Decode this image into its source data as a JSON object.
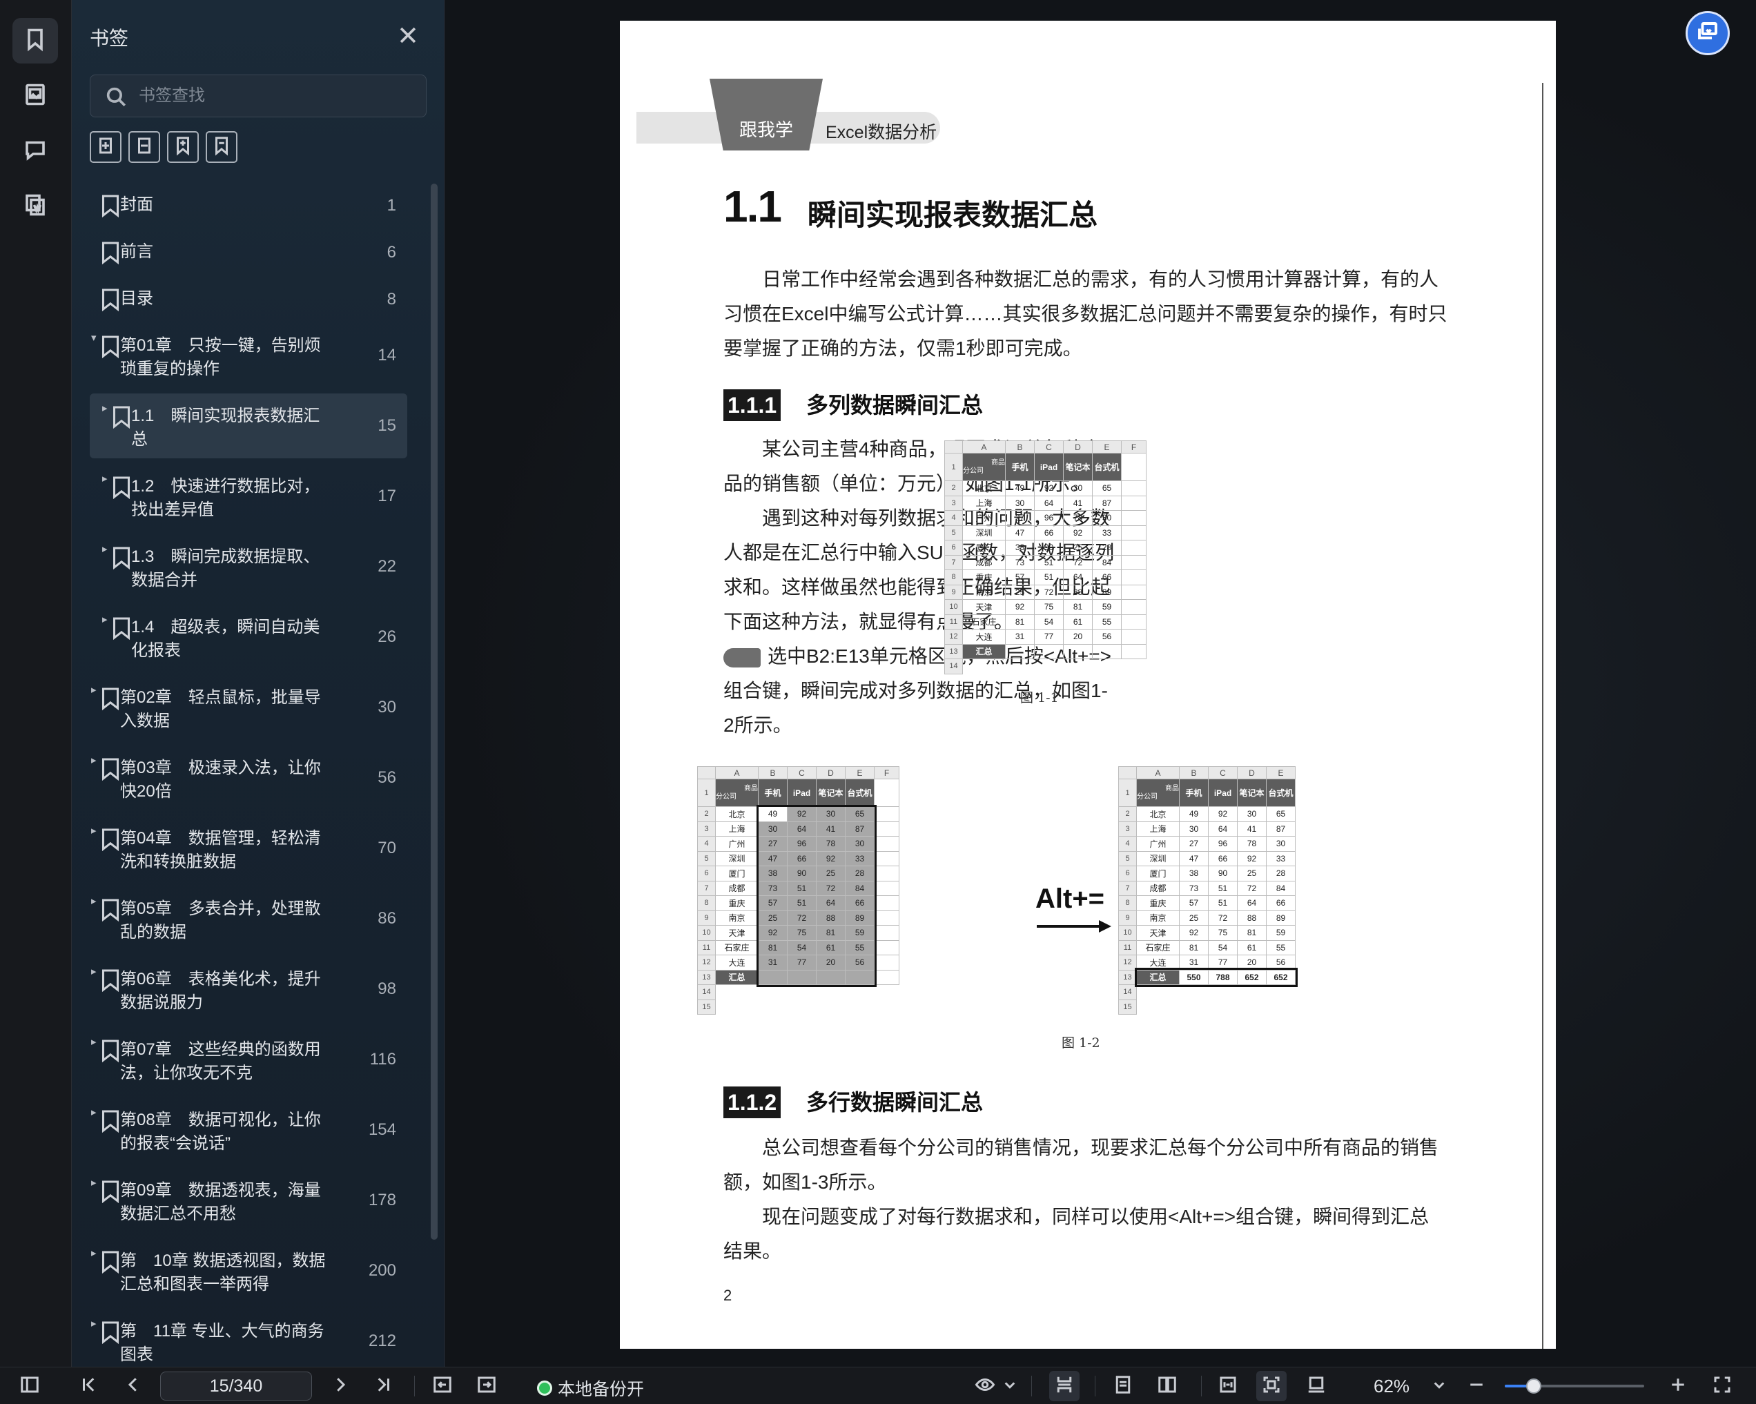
{
  "panel": {
    "title": "书签",
    "search_placeholder": "书签查找",
    "items": [
      {
        "label": "封面",
        "page": "1",
        "level": 0,
        "caret": "",
        "single": true
      },
      {
        "label": "前言",
        "page": "6",
        "level": 0,
        "caret": "",
        "single": true
      },
      {
        "label": "目录",
        "page": "8",
        "level": 0,
        "caret": "",
        "single": true
      },
      {
        "label": "第01章　只按一键，告别烦琐重复的操作",
        "page": "14",
        "level": 0,
        "caret": "▾",
        "single": false
      },
      {
        "label": "1.1　瞬间实现报表数据汇总",
        "page": "15",
        "level": 1,
        "caret": "▸",
        "single": false,
        "selected": true
      },
      {
        "label": "1.2　快速进行数据比对，找出差异值",
        "page": "17",
        "level": 1,
        "caret": "▸",
        "single": false
      },
      {
        "label": "1.3　瞬间完成数据提取、数据合并",
        "page": "22",
        "level": 1,
        "caret": "▸",
        "single": false
      },
      {
        "label": "1.4　超级表，瞬间自动美化报表",
        "page": "26",
        "level": 1,
        "caret": "▸",
        "single": false
      },
      {
        "label": "第02章　轻点鼠标，批量导入数据",
        "page": "30",
        "level": 0,
        "caret": "▸",
        "single": false
      },
      {
        "label": "第03章　极速录入法，让你快20倍",
        "page": "56",
        "level": 0,
        "caret": "▸",
        "single": false
      },
      {
        "label": "第04章　数据管理，轻松清洗和转换脏数据",
        "page": "70",
        "level": 0,
        "caret": "▸",
        "single": false
      },
      {
        "label": "第05章　多表合并，处理散乱的数据",
        "page": "86",
        "level": 0,
        "caret": "▸",
        "single": false
      },
      {
        "label": "第06章　表格美化术，提升数据说服力",
        "page": "98",
        "level": 0,
        "caret": "▸",
        "single": false
      },
      {
        "label": "第07章　这些经典的函数用法，让你攻无不克",
        "page": "116",
        "level": 0,
        "caret": "▸",
        "single": false
      },
      {
        "label": "第08章　数据可视化，让你的报表“会说话”",
        "page": "154",
        "level": 0,
        "caret": "▸",
        "single": false
      },
      {
        "label": "第09章　数据透视表，海量数据汇总不用愁",
        "page": "178",
        "level": 0,
        "caret": "▸",
        "single": false
      },
      {
        "label": "第　10章 数据透视图，数据汇总和图表一举两得",
        "page": "200",
        "level": 0,
        "caret": "▸",
        "single": false
      },
      {
        "label": "第　11章 专业、大气的商务图表",
        "page": "212",
        "level": 0,
        "caret": "▸",
        "single": false
      }
    ]
  },
  "page": {
    "header_badge": "跟我学",
    "header_text": "Excel数据分析",
    "h1_num": "1.1",
    "h1": "瞬间实现报表数据汇总",
    "intro": "日常工作中经常会遇到各种数据汇总的需求，有的人习惯用计算器计算，有的人习惯在Excel中编写公式计算……其实很多数据汇总问题并不需要复杂的操作，有时只要掌握了正确的方法，仅需1秒即可完成。",
    "s1_num": "1.1.1",
    "s1_title": "多列数据瞬间汇总",
    "s1_p1": "某公司主营4种商品，现要求汇总每种商品的销售额（单位：万元），如图1-1所示。",
    "s1_p2": "遇到这种对每列数据求和的问题，大多数人都是在汇总行中输入SUM函数，对数据逐列求和。这样做虽然也能得到正确结果，但比起下面这种方法，就显得有点慢了。",
    "s1_step": "选中B2:E13单元格区域，然后按<Alt+=>组合键，瞬间完成对多列数据的汇总，如图1-2所示。",
    "fig1": "图 1-1",
    "fig2": "图 1-2",
    "alt_label": "Alt+=",
    "s2_num": "1.1.2",
    "s2_title": "多行数据瞬间汇总",
    "s2_p1": "总公司想查看每个分公司的销售情况，现要求汇总每个分公司中所有商品的销售额，如图1-3所示。",
    "s2_p2": "现在问题变成了对每行数据求和，同样可以使用<Alt+=>组合键，瞬间得到汇总结果。",
    "page_number": "2",
    "sheet": {
      "cols": [
        "A",
        "B",
        "C",
        "D",
        "E",
        "F"
      ],
      "corner_top": "商品",
      "corner_bottom": "分公司",
      "headers": [
        "手机",
        "iPad",
        "笔记本",
        "台式机"
      ],
      "rows": [
        {
          "name": "北京",
          "v": [
            "49",
            "92",
            "30",
            "65"
          ]
        },
        {
          "name": "上海",
          "v": [
            "30",
            "64",
            "41",
            "87"
          ]
        },
        {
          "name": "广州",
          "v": [
            "27",
            "96",
            "78",
            "30"
          ]
        },
        {
          "name": "深圳",
          "v": [
            "47",
            "66",
            "92",
            "33"
          ]
        },
        {
          "name": "厦门",
          "v": [
            "38",
            "90",
            "25",
            "28"
          ]
        },
        {
          "name": "成都",
          "v": [
            "73",
            "51",
            "72",
            "84"
          ]
        },
        {
          "name": "重庆",
          "v": [
            "57",
            "51",
            "64",
            "66"
          ]
        },
        {
          "name": "南京",
          "v": [
            "25",
            "72",
            "88",
            "89"
          ]
        },
        {
          "name": "天津",
          "v": [
            "92",
            "75",
            "81",
            "59"
          ]
        },
        {
          "name": "石家庄",
          "v": [
            "81",
            "54",
            "61",
            "55"
          ]
        },
        {
          "name": "大连",
          "v": [
            "31",
            "77",
            "20",
            "56"
          ]
        }
      ],
      "sum_label": "汇总",
      "sums": [
        "550",
        "788",
        "652",
        "652"
      ]
    }
  },
  "toolbar": {
    "page_value": "15/340",
    "backup_label": "本地备份开",
    "zoom": "62%",
    "zoom_fraction": 0.21
  },
  "colors": {
    "accent": "#2f6fe0",
    "backup_dot": "#2fbf5b",
    "zoom_fill": "#3b82f6"
  }
}
